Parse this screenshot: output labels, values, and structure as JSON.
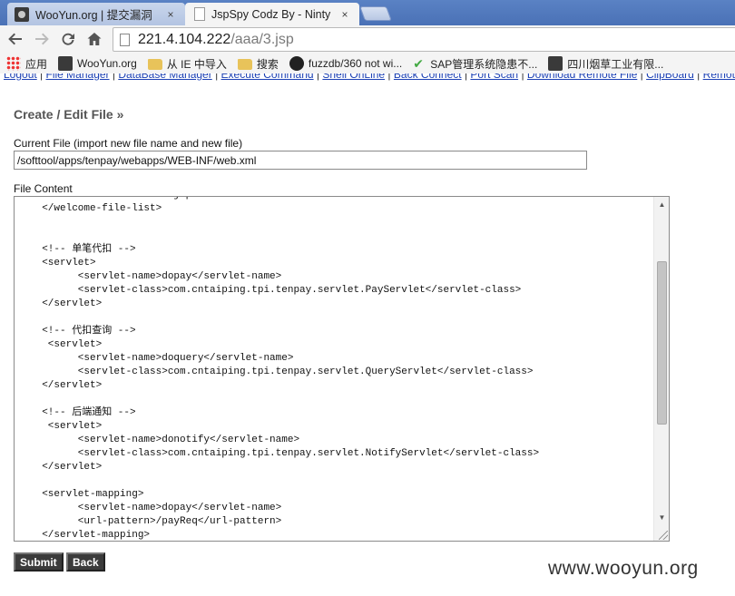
{
  "browser": {
    "tabs": [
      {
        "label": "WooYun.org | 提交漏洞",
        "favicon": "wooyun-icon",
        "active": false
      },
      {
        "label": "JspSpy Codz By - Ninty",
        "favicon": "page-icon",
        "active": true
      }
    ],
    "close_glyph": "×",
    "url": {
      "host": "221.4.104.222",
      "path": "/aaa/3.jsp"
    },
    "bookmarks": [
      {
        "label": "应用",
        "icon": "apps-icon"
      },
      {
        "label": "WooYun.org",
        "icon": "wooyun-icon"
      },
      {
        "label": "从 IE 中导入",
        "icon": "folder-icon"
      },
      {
        "label": "搜索",
        "icon": "folder-icon"
      },
      {
        "label": "fuzzdb/360 not wi...",
        "icon": "github-icon"
      },
      {
        "label": "SAP管理系统隐患不...",
        "icon": "check-icon"
      },
      {
        "label": "四川烟草工业有限...",
        "icon": "wooyun-icon"
      }
    ]
  },
  "page": {
    "nav_links": [
      "Logout",
      "File Manager",
      "DataBase Manager",
      "Execute Command",
      "Shell OnLine",
      "Back Connect",
      "Port Scan",
      "Download Remote File",
      "ClipBoard",
      "Remote"
    ],
    "title": "Create / Edit File »",
    "current_file_label": "Current File (import new file name and new file)",
    "current_file_value": "/softtool/apps/tenpay/webapps/WEB-INF/web.xml",
    "file_content_label": "File Content",
    "file_content": "    <welcome-file>index.jsp</welcome-file>\n  </welcome-file-list>\n\n\n  <!-- 单笔代扣 -->\n  <servlet>\n        <servlet-name>dopay</servlet-name>\n        <servlet-class>com.cntaiping.tpi.tenpay.servlet.PayServlet</servlet-class>\n  </servlet>\n\n  <!-- 代扣查询 -->\n   <servlet>\n        <servlet-name>doquery</servlet-name>\n        <servlet-class>com.cntaiping.tpi.tenpay.servlet.QueryServlet</servlet-class>\n  </servlet>\n\n  <!-- 后端通知 -->\n   <servlet>\n        <servlet-name>donotify</servlet-name>\n        <servlet-class>com.cntaiping.tpi.tenpay.servlet.NotifyServlet</servlet-class>\n  </servlet>\n\n  <servlet-mapping>\n        <servlet-name>dopay</servlet-name>\n        <url-pattern>/payReq</url-pattern>\n  </servlet-mapping>",
    "submit_label": "Submit",
    "back_label": "Back",
    "watermark": "www.wooyun.org"
  }
}
